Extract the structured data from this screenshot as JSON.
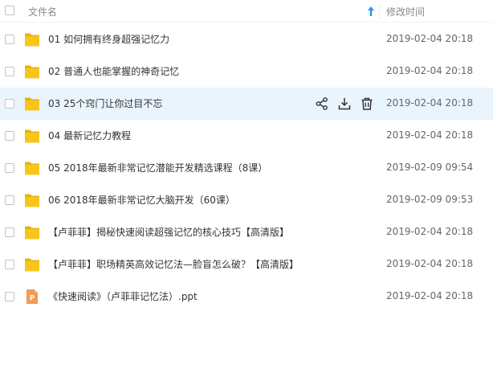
{
  "header": {
    "name_label": "文件名",
    "time_label": "修改时间",
    "sort_icon": "sort-arrow-up-icon"
  },
  "colors": {
    "folder": "#f8c51c",
    "ppt": "#f39a55",
    "highlight": "#eaf4fd",
    "accent": "#2b91f0"
  },
  "rows": [
    {
      "name": "01 如何拥有终身超强记忆力",
      "time": "2019-02-04 20:18",
      "type": "folder"
    },
    {
      "name": "02 普通人也能掌握的神奇记忆",
      "time": "2019-02-04 20:18",
      "type": "folder"
    },
    {
      "name": "03 25个窍门让你过目不忘",
      "time": "2019-02-04 20:18",
      "type": "folder",
      "hovered": true
    },
    {
      "name": "04 最新记忆力教程",
      "time": "2019-02-04 20:18",
      "type": "folder"
    },
    {
      "name": "05 2018年最新非常记忆潜能开发精选课程（8课）",
      "time": "2019-02-09 09:54",
      "type": "folder"
    },
    {
      "name": "06 2018年最新非常记忆大脑开发（60课）",
      "time": "2019-02-09 09:53",
      "type": "folder"
    },
    {
      "name": "【卢菲菲】揭秘快速阅读超强记忆的核心技巧【高清版】",
      "time": "2019-02-04 20:18",
      "type": "folder"
    },
    {
      "name": "【卢菲菲】职场精英高效记忆法—脸盲怎么破？【高清版】",
      "time": "2019-02-04 20:18",
      "type": "folder"
    },
    {
      "name": "《快速阅读》（卢菲菲记忆法）.ppt",
      "time": "2019-02-04 20:18",
      "type": "ppt",
      "badge": "P"
    }
  ],
  "row_actions": [
    {
      "name": "share-icon"
    },
    {
      "name": "download-icon"
    },
    {
      "name": "delete-icon"
    }
  ]
}
